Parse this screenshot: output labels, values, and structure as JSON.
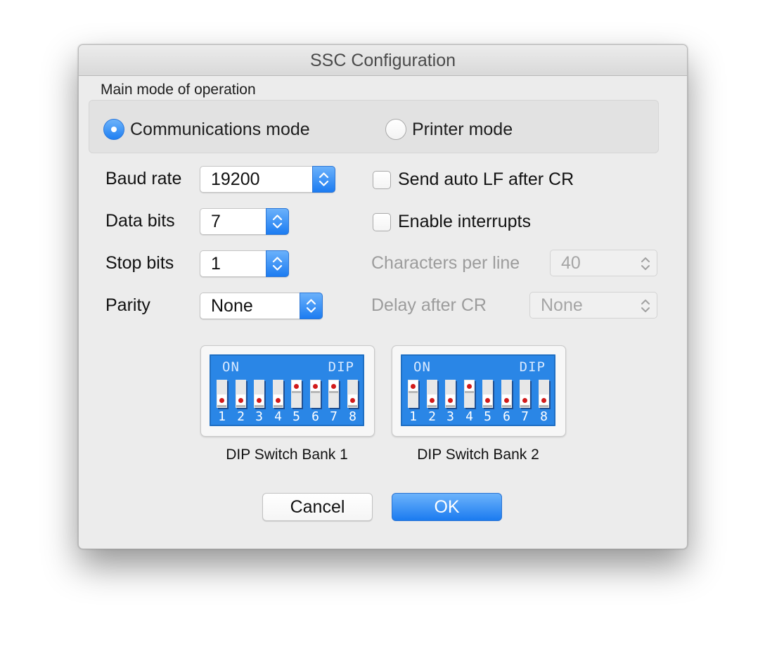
{
  "window": {
    "title": "SSC Configuration"
  },
  "mode_group": {
    "label": "Main mode of operation",
    "options": [
      {
        "label": "Communications mode",
        "selected": true
      },
      {
        "label": "Printer mode",
        "selected": false
      }
    ]
  },
  "fields": {
    "baud_rate": {
      "label": "Baud rate",
      "value": "19200"
    },
    "data_bits": {
      "label": "Data bits",
      "value": "7"
    },
    "stop_bits": {
      "label": "Stop bits",
      "value": "1"
    },
    "parity": {
      "label": "Parity",
      "value": "None"
    },
    "chars_per_line": {
      "label": "Characters per line",
      "value": "40",
      "enabled": false
    },
    "delay_after_cr": {
      "label": "Delay after CR",
      "value": "None",
      "enabled": false
    }
  },
  "checkboxes": {
    "auto_lf": {
      "label": "Send auto LF after CR",
      "checked": false
    },
    "interrupts": {
      "label": "Enable interrupts",
      "checked": false
    }
  },
  "dip_banks": [
    {
      "caption": "DIP Switch Bank 1",
      "on_label": "ON",
      "dip_label": "DIP",
      "switch_numbers": [
        "1",
        "2",
        "3",
        "4",
        "5",
        "6",
        "7",
        "8"
      ],
      "switches_on": [
        false,
        false,
        false,
        false,
        true,
        true,
        true,
        false
      ]
    },
    {
      "caption": "DIP Switch Bank 2",
      "on_label": "ON",
      "dip_label": "DIP",
      "switch_numbers": [
        "1",
        "2",
        "3",
        "4",
        "5",
        "6",
        "7",
        "8"
      ],
      "switches_on": [
        true,
        false,
        false,
        true,
        false,
        false,
        false,
        false
      ]
    }
  ],
  "buttons": {
    "cancel": "Cancel",
    "ok": "OK"
  },
  "colors": {
    "accent": "#1f7ff2",
    "dip_board": "#2a86e6",
    "dip_pip": "#d21b1b"
  },
  "icons": {
    "stepper": "up-down-chevron-icon"
  }
}
